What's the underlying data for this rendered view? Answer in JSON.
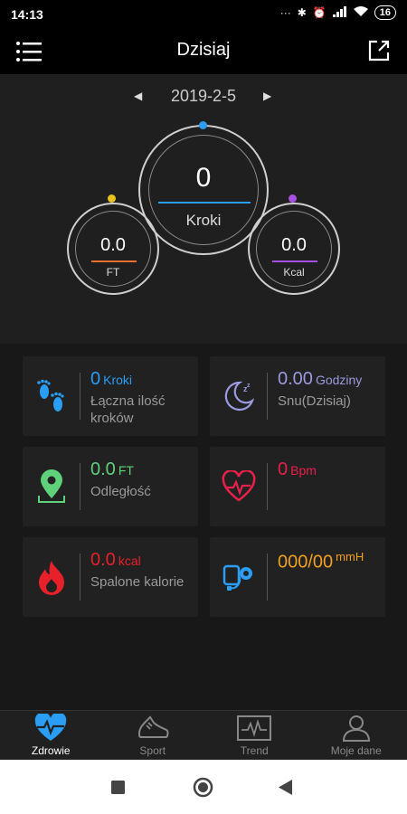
{
  "status": {
    "time": "14:13",
    "battery": "16"
  },
  "header": {
    "title": "Dzisiaj"
  },
  "date": {
    "value": "2019-2-5"
  },
  "rings": {
    "steps": {
      "value": "0",
      "label": "Kroki",
      "accent": "#2a9df4"
    },
    "distance": {
      "value": "0.0",
      "label": "FT",
      "accent": "#e8c21a"
    },
    "calories": {
      "value": "0.0",
      "label": "Kcal",
      "accent": "#a64fe0"
    }
  },
  "cards": [
    {
      "value": "0",
      "unit": "Kroki",
      "sub": "Łączna ilość kroków",
      "color": "#2a9df4",
      "icon": "footprints-icon"
    },
    {
      "value": "0.00",
      "unit": "Godziny",
      "sub": "Snu(Dzisiaj)",
      "color": "#9a9ae0",
      "icon": "moon-sleep-icon"
    },
    {
      "value": "0.0",
      "unit": "FT",
      "sub": "Odległość",
      "color": "#5fd17a",
      "icon": "location-pin-icon"
    },
    {
      "value": "0",
      "unit": "Bpm",
      "sub": "",
      "color": "#e8204a",
      "icon": "heart-rate-icon"
    },
    {
      "value": "0.0",
      "unit": "kcal",
      "sub": "Spalone kalorie",
      "color": "#e8202a",
      "icon": "flame-icon"
    },
    {
      "value": "000/00",
      "unit": "mmH",
      "sub": "",
      "color": "#f0a020",
      "icon": "blood-pressure-icon"
    }
  ],
  "nav": [
    {
      "label": "Zdrowie",
      "icon": "heart-pulse-icon"
    },
    {
      "label": "Sport",
      "icon": "shoe-icon"
    },
    {
      "label": "Trend",
      "icon": "trend-chart-icon"
    },
    {
      "label": "Moje dane",
      "icon": "user-icon"
    }
  ]
}
